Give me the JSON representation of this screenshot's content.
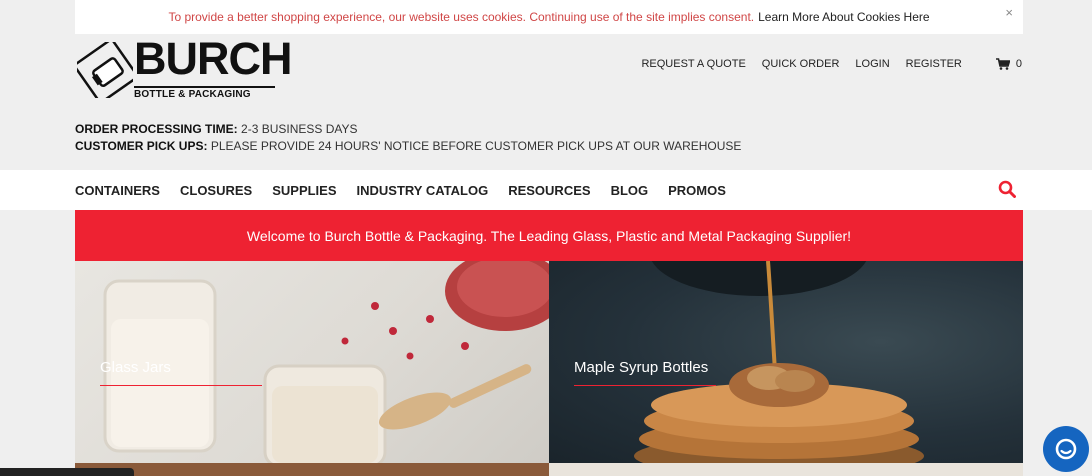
{
  "cookie": {
    "message": "To provide a better shopping experience, our website uses cookies. Continuing use of the site implies consent.",
    "link": "Learn More About Cookies Here",
    "close": "×"
  },
  "logo": {
    "word": "BURCH",
    "sub": "BOTTLE & PACKAGING"
  },
  "top_links": {
    "request_quote": "REQUEST A QUOTE",
    "quick_order": "QUICK ORDER",
    "login": "LOGIN",
    "register": "REGISTER",
    "cart_count": "0"
  },
  "notice": {
    "processing_label": "ORDER PROCESSING TIME:",
    "processing_value": "2-3 BUSINESS DAYS",
    "pickup_label": "CUSTOMER PICK UPS:",
    "pickup_value": "PLEASE PROVIDE 24 HOURS' NOTICE BEFORE CUSTOMER PICK UPS AT OUR WAREHOUSE"
  },
  "nav": [
    "CONTAINERS",
    "CLOSURES",
    "SUPPLIES",
    "INDUSTRY CATALOG",
    "RESOURCES",
    "BLOG",
    "PROMOS"
  ],
  "welcome": "Welcome to Burch Bottle & Packaging. The Leading Glass, Plastic and Metal Packaging Supplier!",
  "tiles": [
    {
      "label": "Glass Jars"
    },
    {
      "label": "Maple Syrup Bottles"
    }
  ],
  "colors": {
    "accent": "#ee2232",
    "chat": "#1565c0"
  }
}
